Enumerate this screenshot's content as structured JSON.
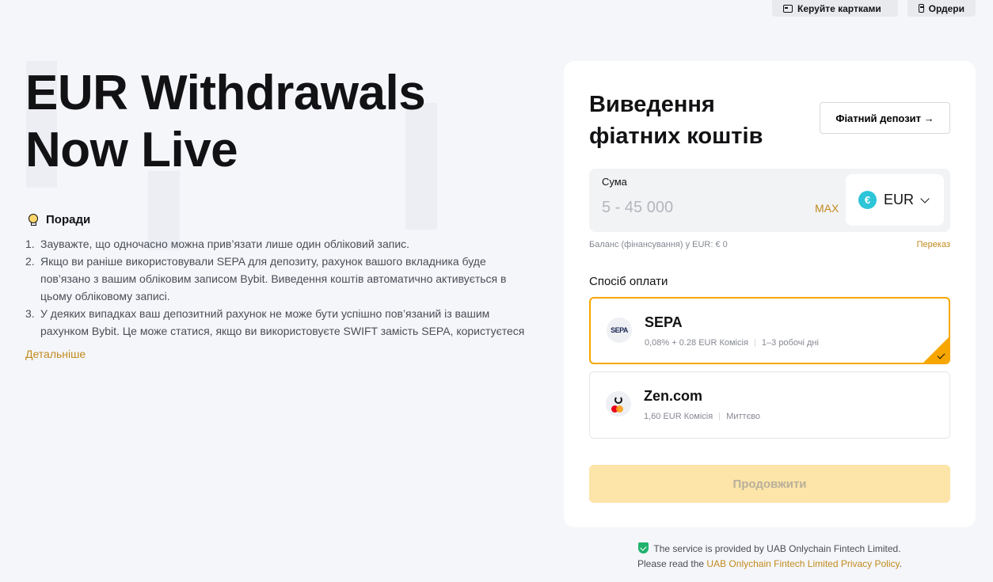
{
  "topbar": {
    "manage_cards": "Керуйте картками",
    "orders": "Ордери"
  },
  "hero": {
    "title": "EUR Withdrawals Now Live"
  },
  "tips": {
    "heading": "Поради",
    "items": [
      {
        "num": "1.",
        "text": "Зауважте, що одночасно можна прив’язати лише один обліковий запис."
      },
      {
        "num": "2.",
        "text": "Якщо ви раніше використовували SEPA для депозиту, рахунок вашого вкладника буде пов’язано з вашим обліковим записом Bybit. Виведення коштів автоматично активується в цьому обліковому записі."
      },
      {
        "num": "3.",
        "text": "У деяких випадках ваш депозитний рахунок не може бути успішно пов’язаний із вашим рахунком Bybit. Це може статися, якщо ви використовуєте SWIFT замість SEPA, користуєтеся"
      }
    ],
    "more_link": "Детальніше"
  },
  "withdraw": {
    "title": "Виведення фіатних коштів",
    "fiat_deposit_btn": "Фіатний депозит →",
    "amount_label": "Сума",
    "amount_placeholder": "5 - 45 000",
    "max_label": "MAX",
    "currency_symbol": "€",
    "currency": "EUR",
    "balance_text": "Баланс (фінансування) у EUR: € 0",
    "transfer_link": "Переказ",
    "payment_label": "Спосіб оплати",
    "methods": [
      {
        "logo": "SEPA",
        "name": "SEPA",
        "fee": "0,08% + 0.28 EUR Комісія",
        "time": "1–3 робочі дні",
        "selected": true
      },
      {
        "name": "Zen.com",
        "fee": "1,60 EUR Комісія",
        "time": "Миттєво",
        "selected": false
      }
    ],
    "continue_btn": "Продовжити"
  },
  "footer": {
    "line1": "The service is provided by UAB Onlychain Fintech Limited.",
    "line2_prefix": "Please read the ",
    "line2_link": "UAB Onlychain Fintech Limited Privacy Policy",
    "line2_suffix": "."
  },
  "colors": {
    "accent": "#f7a600",
    "link": "#c18a1d",
    "button_disabled": "#fde4a8"
  }
}
